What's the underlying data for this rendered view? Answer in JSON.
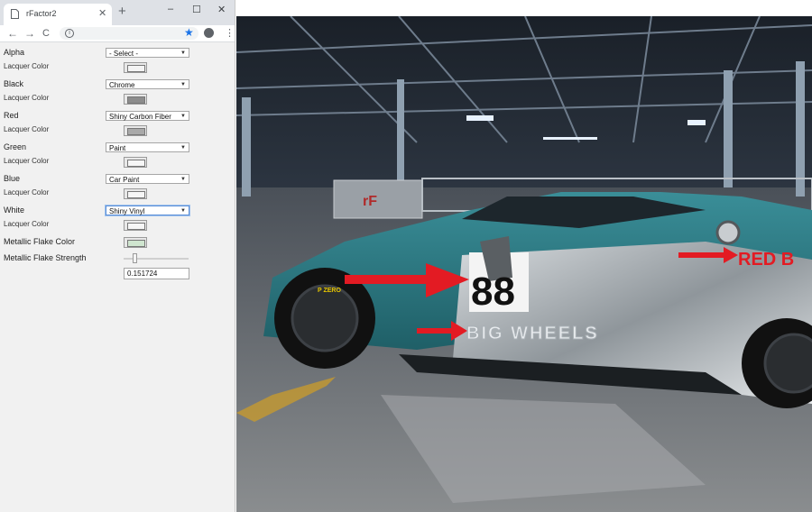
{
  "browser": {
    "tab_title": "rFactor2",
    "new_tab_symbol": "+",
    "window_controls": {
      "minimize": "–",
      "maximize": "☐",
      "close": "✕"
    },
    "toolbar": {
      "back": "←",
      "forward": "→",
      "reload": "C",
      "info": "i",
      "star": "★",
      "menu": "⋮"
    }
  },
  "form": {
    "rows": [
      {
        "label": "Alpha",
        "select": "- Select -",
        "lacquer_label": "Lacquer Color",
        "lacquer_color": "#f4f4f4"
      },
      {
        "label": "Black",
        "select": "Chrome",
        "lacquer_label": "Lacquer Color",
        "lacquer_color": "#8c8c8c"
      },
      {
        "label": "Red",
        "select": "Shiny Carbon Fiber",
        "lacquer_label": "Lacquer Color",
        "lacquer_color": "#a9a9a9"
      },
      {
        "label": "Green",
        "select": "Paint",
        "lacquer_label": "Lacquer Color",
        "lacquer_color": "#f6f6f6"
      },
      {
        "label": "Blue",
        "select": "Car Paint",
        "lacquer_label": "Lacquer Color",
        "lacquer_color": "#f6f6f6"
      },
      {
        "label": "White",
        "select": "Shiny Vinyl",
        "lacquer_label": "Lacquer Color",
        "lacquer_color": "#f6f6f6"
      }
    ],
    "metallic_flake_color_label": "Metallic Flake Color",
    "metallic_flake_color": "#cfe5cf",
    "metallic_flake_strength_label": "Metallic Flake Strength",
    "metallic_flake_strength_value": "0.151724"
  },
  "viewport": {
    "car_number": "88",
    "side_text": "BIG WHEELS",
    "tire_text": "P ZERO",
    "rear_text": "RED B",
    "accent_colors": {
      "teal": "#2f7d86",
      "red_arrow": "#e31b23",
      "chrome": "#b9bec2"
    }
  }
}
